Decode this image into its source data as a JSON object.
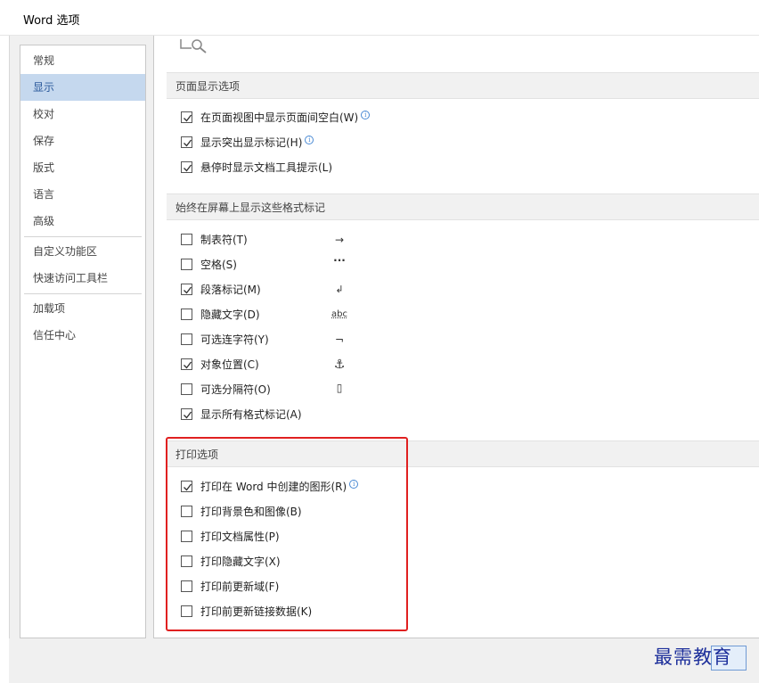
{
  "window": {
    "title": "Word 选项"
  },
  "sidebar": {
    "items": [
      {
        "label": "常规",
        "active": false
      },
      {
        "label": "显示",
        "active": true
      },
      {
        "label": "校对",
        "active": false
      },
      {
        "label": "保存",
        "active": false
      },
      {
        "label": "版式",
        "active": false
      },
      {
        "label": "语言",
        "active": false
      },
      {
        "label": "高级",
        "active": false
      },
      {
        "label": "自定义功能区",
        "active": false
      },
      {
        "label": "快速访问工具栏",
        "active": false
      },
      {
        "label": "加载项",
        "active": false
      },
      {
        "label": "信任中心",
        "active": false
      }
    ]
  },
  "page_display": {
    "header": "页面显示选项",
    "options": [
      {
        "label": "在页面视图中显示页面间空白(W)",
        "checked": true,
        "info": true
      },
      {
        "label": "显示突出显示标记(H)",
        "checked": true,
        "info": true
      },
      {
        "label": "悬停时显示文档工具提示(L)",
        "checked": true,
        "info": false
      }
    ]
  },
  "format_marks": {
    "header": "始终在屏幕上显示这些格式标记",
    "options": [
      {
        "label": "制表符(T)",
        "checked": false,
        "mark": "→"
      },
      {
        "label": "空格(S)",
        "checked": false,
        "mark": "···"
      },
      {
        "label": "段落标记(M)",
        "checked": true,
        "mark": "↲"
      },
      {
        "label": "隐藏文字(D)",
        "checked": false,
        "mark": "abc"
      },
      {
        "label": "可选连字符(Y)",
        "checked": false,
        "mark": "¬"
      },
      {
        "label": "对象位置(C)",
        "checked": true,
        "mark": "⚓"
      },
      {
        "label": "可选分隔符(O)",
        "checked": false,
        "mark": "▯"
      },
      {
        "label": "显示所有格式标记(A)",
        "checked": true,
        "mark": ""
      }
    ]
  },
  "print_options": {
    "header": "打印选项",
    "options": [
      {
        "label": "打印在 Word 中创建的图形(R)",
        "checked": true,
        "info": true
      },
      {
        "label": "打印背景色和图像(B)",
        "checked": false,
        "info": false
      },
      {
        "label": "打印文档属性(P)",
        "checked": false,
        "info": false
      },
      {
        "label": "打印隐藏文字(X)",
        "checked": false,
        "info": false
      },
      {
        "label": "打印前更新域(F)",
        "checked": false,
        "info": false
      },
      {
        "label": "打印前更新链接数据(K)",
        "checked": false,
        "info": false
      }
    ]
  },
  "info_glyph": "i",
  "watermark": "最需教育",
  "colors": {
    "nav_active_bg": "#c5d8ee",
    "highlight_box": "#e02020",
    "info_icon": "#4a8ad4",
    "watermark": "#1d2f9b"
  }
}
